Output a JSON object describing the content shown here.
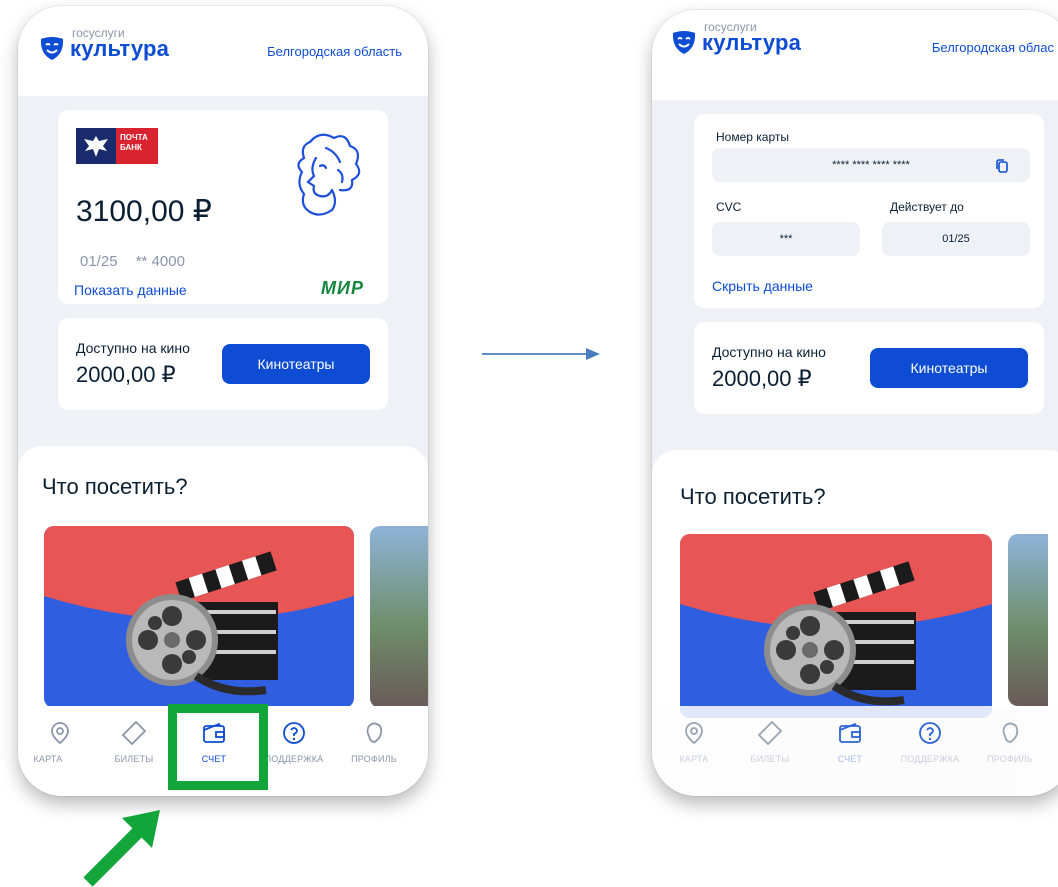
{
  "colors": {
    "accent": "#0d4cd3",
    "highlight": "#11a53a",
    "mir": "#16853e",
    "bank_red": "#d9232f",
    "bank_navy": "#1a2b6d",
    "promo_red": "#e85555",
    "promo_blue": "#2f5fe0"
  },
  "header": {
    "logo_small": "госуслуги",
    "logo_big": "культура",
    "region": "Белгородская область",
    "region_cropped": "Белгородская облас"
  },
  "card": {
    "bank_name_line1": "ПОЧТА",
    "bank_name_line2": "БАНК",
    "balance": "3100,00 ₽",
    "expiry": "01/25",
    "masked_number": "** 4000",
    "show_details_link": "Показать данные",
    "payment_system": "МИР"
  },
  "card_details": {
    "number_label": "Номер карты",
    "number_value": "**** **** **** ****",
    "cvc_label": "CVC",
    "cvc_value": "***",
    "valid_label": "Действует до",
    "valid_value": "01/25",
    "hide_details_link": "Скрыть данные"
  },
  "cinema": {
    "label": "Доступно на кино",
    "value": "2000,00 ₽",
    "button": "Кинотеатры"
  },
  "section": {
    "title": "Что посетить?"
  },
  "tabbar": {
    "items": [
      {
        "label": "КАРТА",
        "icon": "map-pin-icon"
      },
      {
        "label": "БИЛЕТЫ",
        "icon": "ticket-icon"
      },
      {
        "label": "СЧЕТ",
        "icon": "wallet-icon"
      },
      {
        "label": "ПОДДЕРЖКА",
        "icon": "support-icon"
      },
      {
        "label": "ПРОФИЛЬ",
        "icon": "profile-icon"
      }
    ],
    "active": "СЧЕТ"
  },
  "icons": {
    "logo": "theater-mask-icon",
    "copy": "copy-icon",
    "pushkin_card": "pushkin-portrait-icon",
    "promo": "film-reel-clapperboard-icon",
    "annotation_pointer": "green-arrow-icon",
    "flow": "right-arrow-icon"
  }
}
